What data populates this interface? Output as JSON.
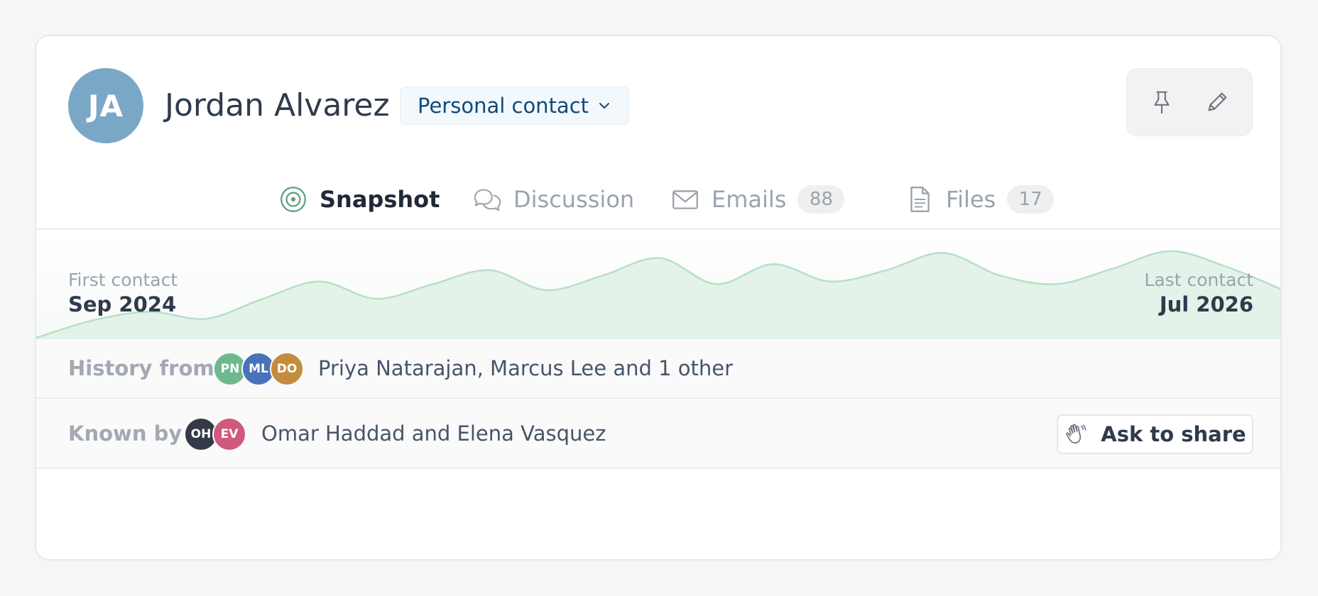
{
  "contact": {
    "initials": "JA",
    "name": "Jordan Alvarez",
    "type_label": "Personal contact",
    "avatar_color": "#7ba7c7"
  },
  "actions": {
    "pin_icon": "pin-icon",
    "edit_icon": "pencil-icon"
  },
  "tabs": [
    {
      "label": "Snapshot",
      "icon": "target-icon",
      "active": true
    },
    {
      "label": "Discussion",
      "icon": "chat-bubbles-icon",
      "active": false
    },
    {
      "label": "Emails",
      "icon": "envelope-icon",
      "count": "88",
      "active": false
    },
    {
      "label": "Files",
      "icon": "document-icon",
      "count": "17",
      "active": false
    }
  ],
  "timeline": {
    "first_label": "First contact",
    "first_value": "Sep 2024",
    "last_label": "Last contact",
    "last_value": "Jul 2026",
    "activity_levels": [
      0.0,
      0.2,
      0.3,
      0.22,
      0.45,
      0.65,
      0.45,
      0.62,
      0.78,
      0.55,
      0.72,
      0.92,
      0.62,
      0.85,
      0.65,
      0.78,
      0.98,
      0.72,
      0.62,
      0.8,
      1.0,
      0.82,
      0.55
    ],
    "fill_color": "#e3f3e9",
    "stroke_color": "#b7e0c6"
  },
  "history": {
    "label": "History from",
    "people": [
      {
        "initials": "PN",
        "color": "#6db88c"
      },
      {
        "initials": "ML",
        "color": "#4a72b8"
      },
      {
        "initials": "DO",
        "color": "#c48c3e"
      }
    ],
    "text": "Priya Natarajan, Marcus Lee and 1 other"
  },
  "known_by": {
    "label": "Known by",
    "people": [
      {
        "initials": "OH",
        "color": "#333a47"
      },
      {
        "initials": "EV",
        "color": "#d05a7e"
      }
    ],
    "text": "Omar Haddad and Elena Vasquez",
    "share_label": "Ask to share",
    "share_icon": "waving-hand-icon"
  },
  "colors": {
    "accent": "#5ea381",
    "link": "#0f4a7a"
  }
}
